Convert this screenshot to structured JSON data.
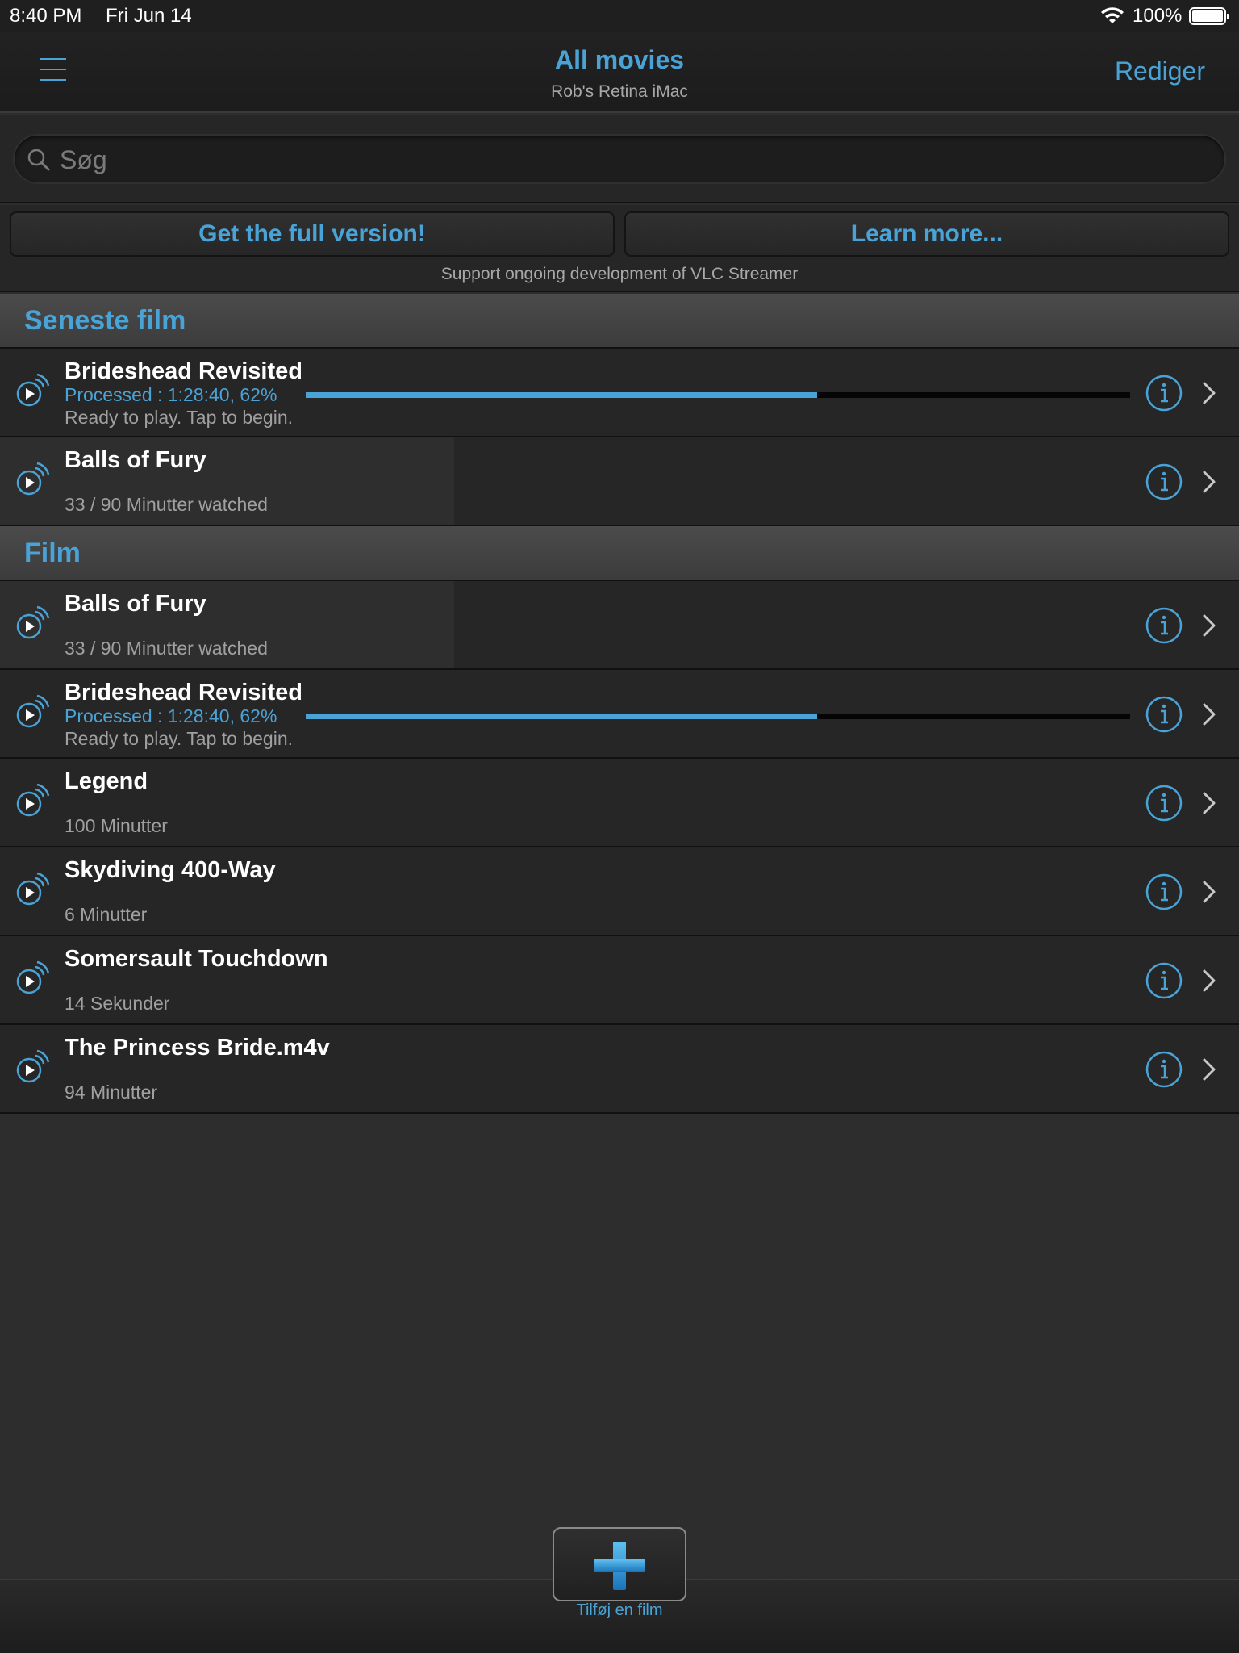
{
  "status_bar": {
    "time": "8:40 PM",
    "date": "Fri Jun 14",
    "battery": "100%"
  },
  "nav": {
    "title": "All movies",
    "subtitle": "Rob's Retina iMac",
    "edit_label": "Rediger"
  },
  "search": {
    "placeholder": "Søg"
  },
  "promo": {
    "full_version_label": "Get the full version!",
    "learn_more_label": "Learn more...",
    "caption": "Support ongoing development of VLC Streamer"
  },
  "sections": [
    {
      "title": "Seneste film",
      "rows": [
        {
          "title": "Brideshead Revisited",
          "processed": "Processed : 1:28:40, 62%",
          "progress": 0.62,
          "subtitle": "Ready to play. Tap to begin."
        },
        {
          "title": "Balls of Fury",
          "subtitle": "33 / 90 Minutter watched",
          "watched": 0.3667
        }
      ]
    },
    {
      "title": "Film",
      "rows": [
        {
          "title": "Balls of Fury",
          "subtitle": "33 / 90 Minutter watched",
          "watched": 0.3667
        },
        {
          "title": "Brideshead Revisited",
          "processed": "Processed : 1:28:40, 62%",
          "progress": 0.62,
          "subtitle": "Ready to play. Tap to begin."
        },
        {
          "title": "Legend",
          "subtitle": "100 Minutter"
        },
        {
          "title": "Skydiving 400-Way",
          "subtitle": "6 Minutter"
        },
        {
          "title": "Somersault Touchdown",
          "subtitle": "14 Sekunder"
        },
        {
          "title": "The Princess Bride.m4v",
          "subtitle": "94 Minutter"
        }
      ]
    }
  ],
  "toolbar": {
    "add_label": "Tilføj en film"
  },
  "colors": {
    "accent": "#4aa3d6",
    "background": "#2d2d2e",
    "row": "#262627"
  },
  "icons": {
    "menu": "menu-icon",
    "search": "search-icon",
    "play": "play-stream-icon",
    "info": "info-icon",
    "chevron": "chevron-right-icon",
    "add": "plus-icon"
  }
}
